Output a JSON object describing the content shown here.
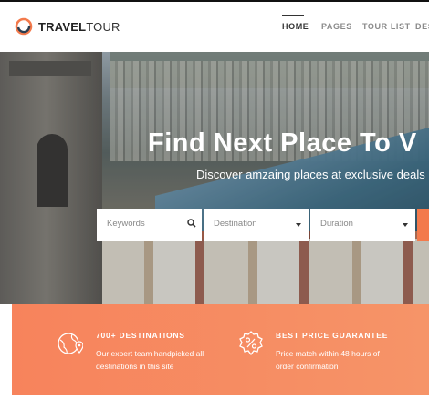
{
  "logo": {
    "part1": "TRAVEL",
    "part2": "TOUR",
    "icon": "travel-tour-logo-icon"
  },
  "nav": [
    {
      "label": "HOME",
      "active": true
    },
    {
      "label": "PAGES",
      "active": false
    },
    {
      "label": "TOUR LIST",
      "active": false
    },
    {
      "label": "DES",
      "active": false
    }
  ],
  "hero": {
    "title": "Find Next Place To V",
    "subtitle": "Discover amzaing places at exclusive deals"
  },
  "search": {
    "keywords_placeholder": "Keywords",
    "destination_placeholder": "Destination",
    "duration_placeholder": "Duration"
  },
  "features": [
    {
      "icon": "globe-pin-icon",
      "title": "700+ DESTINATIONS",
      "description": "Our expert team handpicked all destinations in this site"
    },
    {
      "icon": "percent-badge-icon",
      "title": "BEST PRICE GUARANTEE",
      "description": "Price match within 48 hours of order confirmation"
    }
  ],
  "colors": {
    "accent": "#f37a4c",
    "feature_band": "#f7835c",
    "nav_active": "#333333"
  }
}
